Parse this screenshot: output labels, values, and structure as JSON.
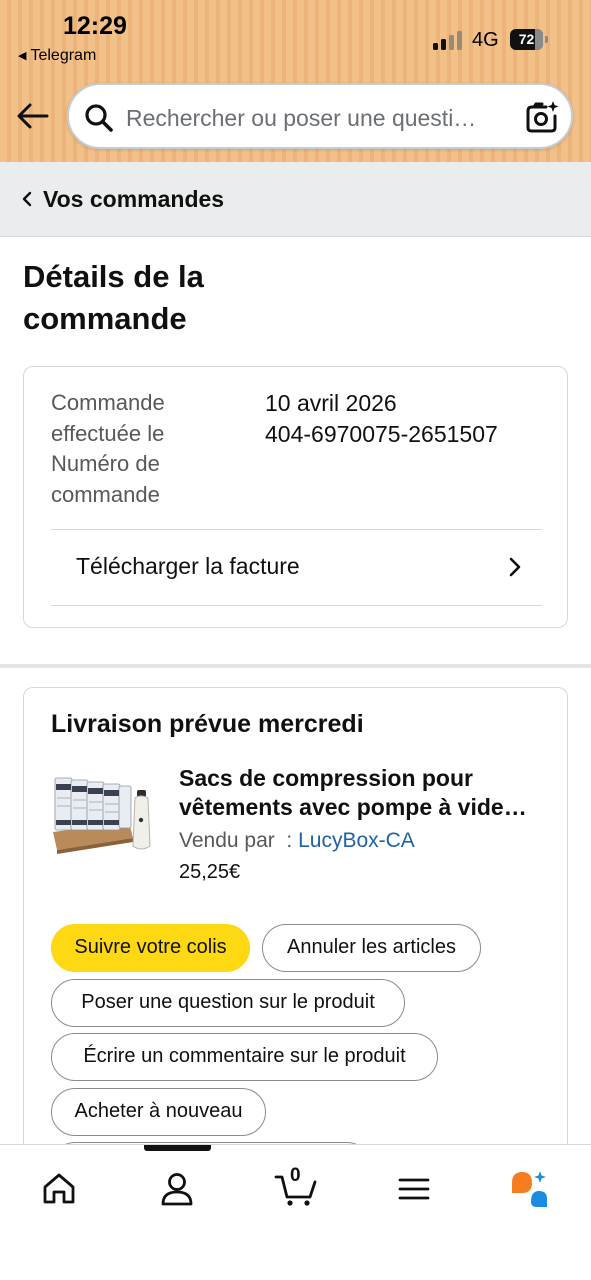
{
  "status_bar": {
    "time": "12:29",
    "back_app": "Telegram",
    "network": "4G",
    "battery": "72"
  },
  "search": {
    "placeholder": "Rechercher ou poser une questi…"
  },
  "breadcrumb": {
    "label": "Vos commandes"
  },
  "page": {
    "title_line1": "Détails de la",
    "title_line2": "commande"
  },
  "order_info": {
    "date_label_1": "Commande",
    "date_label_2": "effectuée le",
    "number_label_1": "Numéro de",
    "number_label_2": "commande",
    "date_value": "10 avril 2026",
    "number_value": "404-6970075-2651507",
    "invoice_label": "Télécharger la facture"
  },
  "delivery": {
    "title": "Livraison prévue mercredi",
    "product": {
      "name_line1": "Sacs de compression pour",
      "name_line2": "vêtements avec pompe à vide…",
      "seller_prefix": "Vendu par  : ",
      "seller_name": "LucyBox-CA",
      "price": "25,25€"
    },
    "actions": {
      "track": "Suivre votre colis",
      "cancel": "Annuler les articles",
      "ask": "Poser une question sur le produit",
      "review": "Écrire un commentaire sur le produit",
      "buy_again": "Acheter à nouveau"
    }
  },
  "bottom_nav": {
    "cart_count": "0",
    "items": [
      "home-icon",
      "account-icon",
      "cart-icon",
      "menu-icon",
      "rufus-ai-icon"
    ]
  },
  "colors": {
    "primary_button": "#ffd814",
    "link": "#2162a1",
    "header_bg": "#f2c089"
  }
}
